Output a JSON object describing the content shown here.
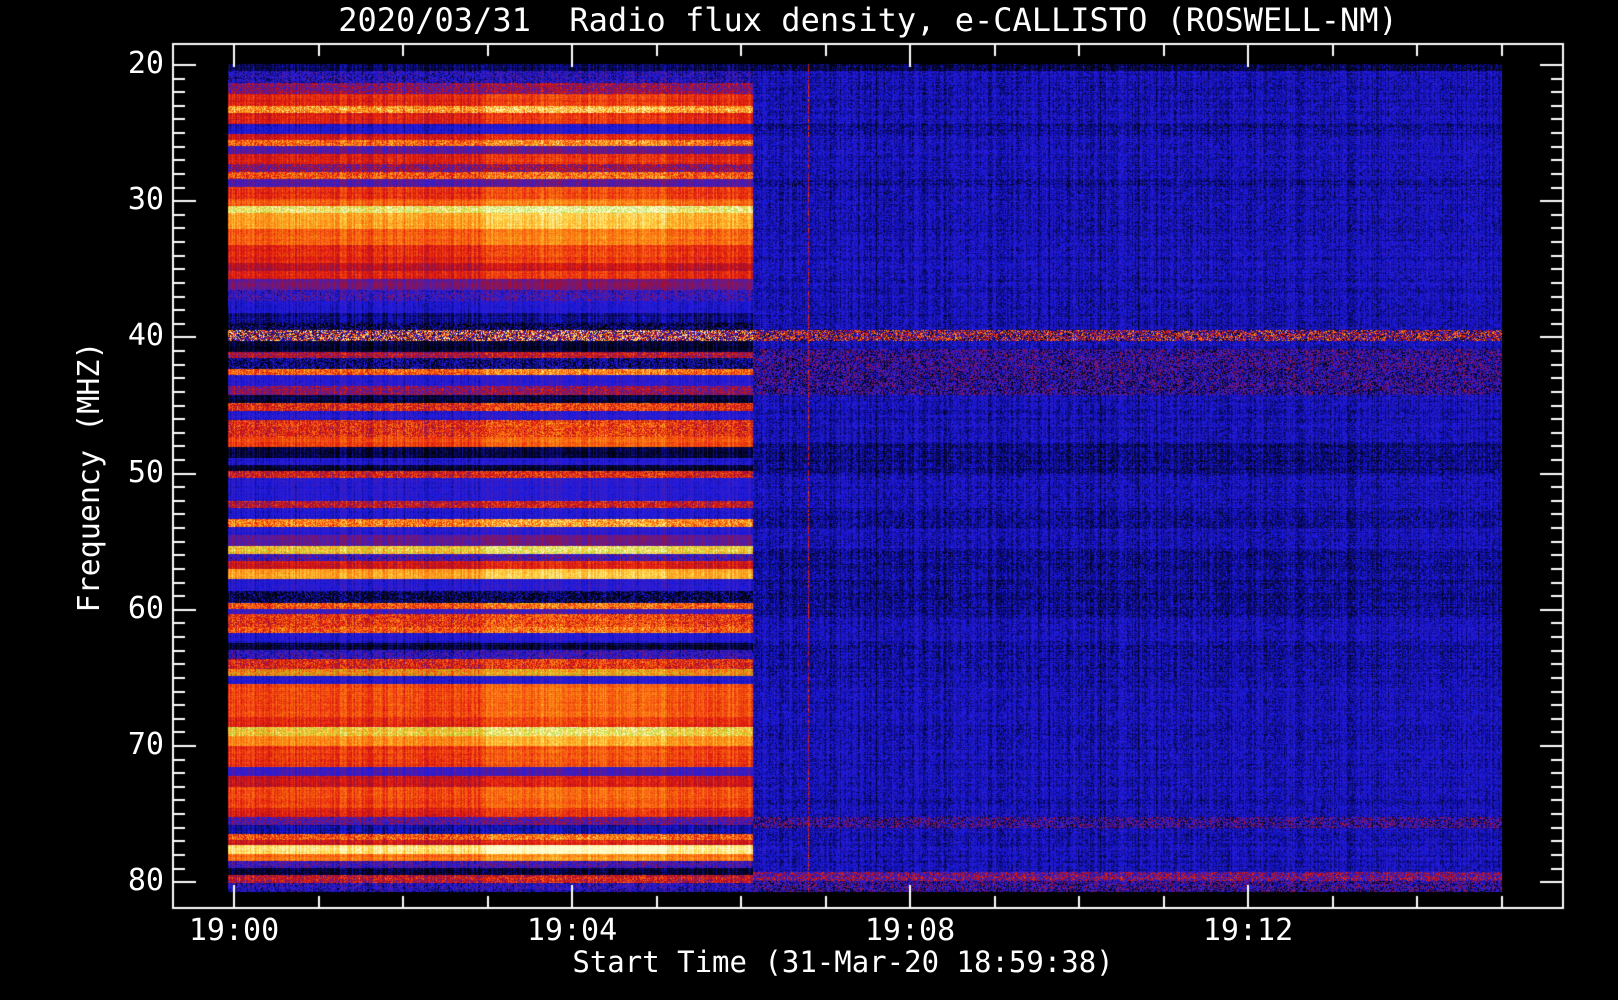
{
  "title": "2020/03/31  Radio flux density, e-CALLISTO (ROSWELL-NM)",
  "colors": {
    "background": "#000000",
    "foreground": "#ffffff",
    "green_speckle": "#96d723"
  },
  "chart_data": {
    "type": "heatmap",
    "title": "2020/03/31  Radio flux density, e-CALLISTO (ROSWELL-NM)",
    "xlabel": "Start Time (31-Mar-20 18:59:38)",
    "ylabel": "Frequency (MHZ)",
    "instrument": "e-CALLISTO (ROSWELL-NM)",
    "date": "2020/03/31",
    "start_time": "18:59:38",
    "x_tick_labels": [
      "19:00",
      "19:04",
      "19:08",
      "19:12"
    ],
    "x_major_minutes": [
      0,
      4,
      8,
      12
    ],
    "x_minor_step_minutes": 1,
    "x_total_minutes": 15,
    "y_ticks_major": [
      20,
      30,
      40,
      50,
      60,
      70,
      80
    ],
    "y_minor_step_mhz": 1,
    "y_range_mhz": [
      19.9,
      80.8
    ],
    "y_axis_inverted": true,
    "grid": false,
    "legend": "none",
    "time_segments": {
      "comment": "fractions of data width; active RFI region ends ~19:06, then quiet blue",
      "boundaries": [
        0.2025,
        0.343,
        0.412
      ],
      "brightness_factors": [
        1.0,
        1.1,
        1.03
      ],
      "quiet_base_level": 0.16
    },
    "palette_stops": [
      [
        0.0,
        2,
        2,
        8
      ],
      [
        0.08,
        8,
        8,
        90
      ],
      [
        0.18,
        25,
        25,
        225
      ],
      [
        0.28,
        55,
        30,
        200
      ],
      [
        0.38,
        110,
        25,
        130
      ],
      [
        0.48,
        165,
        15,
        45
      ],
      [
        0.58,
        225,
        25,
        15
      ],
      [
        0.7,
        248,
        95,
        15
      ],
      [
        0.8,
        252,
        150,
        25
      ],
      [
        0.9,
        253,
        215,
        70
      ],
      [
        1.0,
        255,
        252,
        205
      ]
    ],
    "bands_active_region": [
      [
        19.9,
        20.4,
        0.08,
        "n"
      ],
      [
        20.4,
        21.3,
        0.2,
        "s"
      ],
      [
        21.3,
        22.1,
        0.42,
        "s"
      ],
      [
        22.1,
        23.0,
        0.6,
        "n"
      ],
      [
        23.0,
        23.5,
        0.8,
        "s"
      ],
      [
        23.5,
        24.3,
        0.58,
        "n"
      ],
      [
        24.3,
        25.0,
        0.2,
        "n"
      ],
      [
        25.0,
        25.5,
        0.56,
        "n"
      ],
      [
        25.5,
        25.9,
        0.72,
        "s"
      ],
      [
        25.9,
        26.5,
        0.33,
        "n"
      ],
      [
        26.5,
        27.2,
        0.58,
        "n"
      ],
      [
        27.2,
        27.8,
        0.42,
        "s"
      ],
      [
        27.8,
        28.3,
        0.68,
        "s"
      ],
      [
        28.3,
        28.9,
        0.33,
        "n"
      ],
      [
        28.9,
        29.8,
        0.62,
        "n"
      ],
      [
        29.8,
        30.3,
        0.7,
        "n"
      ],
      [
        30.3,
        30.8,
        0.95,
        "g"
      ],
      [
        30.8,
        32.0,
        0.82,
        "n"
      ],
      [
        32.0,
        33.2,
        0.7,
        "n"
      ],
      [
        33.2,
        34.5,
        0.6,
        "n"
      ],
      [
        34.5,
        35.1,
        0.5,
        "n"
      ],
      [
        35.1,
        35.7,
        0.58,
        "n"
      ],
      [
        35.7,
        36.5,
        0.38,
        "n"
      ],
      [
        36.5,
        37.3,
        0.26,
        "s"
      ],
      [
        37.3,
        38.2,
        0.2,
        "n"
      ],
      [
        38.2,
        38.9,
        0.12,
        "n"
      ],
      [
        38.9,
        39.4,
        0.06,
        "s"
      ],
      [
        39.4,
        40.2,
        0.5,
        "m"
      ],
      [
        40.2,
        41.0,
        0.04,
        "n"
      ],
      [
        41.0,
        41.5,
        0.48,
        "s"
      ],
      [
        41.5,
        42.3,
        0.1,
        "s"
      ],
      [
        42.3,
        42.7,
        0.7,
        "s"
      ],
      [
        42.7,
        43.5,
        0.22,
        "n"
      ],
      [
        43.5,
        44.2,
        0.42,
        "s"
      ],
      [
        44.2,
        44.8,
        0.05,
        "n"
      ],
      [
        44.8,
        45.4,
        0.6,
        "s"
      ],
      [
        45.4,
        46.0,
        0.22,
        "n"
      ],
      [
        46.0,
        47.3,
        0.6,
        "s"
      ],
      [
        47.3,
        48.0,
        0.66,
        "n"
      ],
      [
        48.0,
        48.8,
        0.05,
        "n"
      ],
      [
        48.8,
        49.3,
        0.2,
        "n"
      ],
      [
        49.3,
        49.8,
        0.04,
        "n"
      ],
      [
        49.8,
        50.3,
        0.56,
        "s"
      ],
      [
        50.3,
        52.0,
        0.22,
        "n"
      ],
      [
        52.0,
        52.5,
        0.52,
        "s"
      ],
      [
        52.5,
        53.3,
        0.2,
        "n"
      ],
      [
        53.3,
        53.9,
        0.76,
        "s"
      ],
      [
        53.9,
        54.5,
        0.22,
        "n"
      ],
      [
        54.5,
        55.3,
        0.36,
        "n"
      ],
      [
        55.3,
        55.9,
        0.86,
        "g"
      ],
      [
        55.9,
        56.4,
        0.28,
        "s"
      ],
      [
        56.4,
        57.0,
        0.55,
        "n"
      ],
      [
        57.0,
        57.7,
        0.8,
        "n"
      ],
      [
        57.7,
        58.6,
        0.22,
        "n"
      ],
      [
        58.6,
        59.5,
        0.06,
        "s"
      ],
      [
        59.5,
        59.9,
        0.68,
        "s"
      ],
      [
        59.9,
        60.3,
        0.28,
        "n"
      ],
      [
        60.3,
        61.2,
        0.62,
        "s"
      ],
      [
        61.2,
        61.7,
        0.68,
        "s"
      ],
      [
        61.7,
        62.4,
        0.2,
        "n"
      ],
      [
        62.4,
        62.9,
        0.06,
        "n"
      ],
      [
        62.9,
        63.6,
        0.24,
        "s"
      ],
      [
        63.6,
        64.3,
        0.58,
        "s"
      ],
      [
        64.3,
        64.8,
        0.72,
        "g"
      ],
      [
        64.8,
        65.4,
        0.2,
        "n"
      ],
      [
        65.4,
        67.8,
        0.66,
        "n"
      ],
      [
        67.8,
        68.6,
        0.6,
        "n"
      ],
      [
        68.6,
        69.2,
        0.88,
        "g"
      ],
      [
        69.2,
        70.0,
        0.78,
        "n"
      ],
      [
        70.0,
        71.5,
        0.63,
        "n"
      ],
      [
        71.5,
        72.2,
        0.28,
        "n"
      ],
      [
        72.2,
        73.0,
        0.54,
        "n"
      ],
      [
        73.0,
        74.5,
        0.66,
        "n"
      ],
      [
        74.5,
        75.2,
        0.58,
        "n"
      ],
      [
        75.2,
        75.8,
        0.33,
        "s"
      ],
      [
        75.8,
        76.4,
        0.14,
        "n"
      ],
      [
        76.4,
        76.9,
        0.7,
        "s"
      ],
      [
        76.9,
        77.2,
        0.55,
        "n"
      ],
      [
        77.2,
        77.9,
        0.93,
        "n"
      ],
      [
        77.9,
        78.4,
        0.73,
        "n"
      ],
      [
        78.4,
        78.9,
        0.28,
        "s"
      ],
      [
        78.9,
        79.4,
        0.05,
        "n"
      ],
      [
        79.4,
        80.0,
        0.52,
        "s"
      ],
      [
        80.0,
        80.8,
        0.2,
        "s"
      ]
    ],
    "rows_quiet_region": [
      [
        19.9,
        20.4,
        0.06,
        "n"
      ],
      [
        24.3,
        25.1,
        0.13,
        "n"
      ],
      [
        28.3,
        29.0,
        0.13,
        "n"
      ],
      [
        39.4,
        40.2,
        0.4,
        "m"
      ],
      [
        40.8,
        42.3,
        0.22,
        "s"
      ],
      [
        42.3,
        44.2,
        0.2,
        "s"
      ],
      [
        47.8,
        50.0,
        0.11,
        "n"
      ],
      [
        52.5,
        54.0,
        0.13,
        "n"
      ],
      [
        55.5,
        60.5,
        0.12,
        "n"
      ],
      [
        62.5,
        65.5,
        0.14,
        "n"
      ],
      [
        75.2,
        76.0,
        0.24,
        "s"
      ],
      [
        79.2,
        79.9,
        0.38,
        "s"
      ],
      [
        79.9,
        80.8,
        0.22,
        "s"
      ]
    ],
    "burst_line": {
      "time_fraction": 0.455,
      "level": 0.5
    }
  },
  "y_axis": {
    "tick_labels": [
      "20",
      "30",
      "40",
      "50",
      "60",
      "70",
      "80"
    ]
  },
  "x_axis": {
    "tick_labels": [
      "19:00",
      "19:04",
      "19:08",
      "19:12"
    ]
  }
}
